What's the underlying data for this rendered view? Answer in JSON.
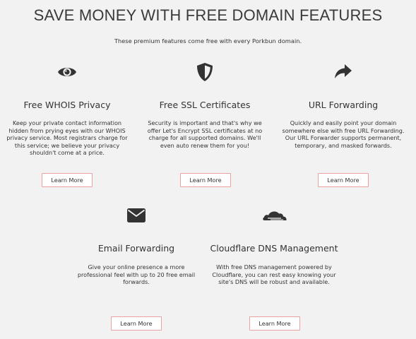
{
  "header": {
    "title": "SAVE MONEY WITH FREE DOMAIN FEATURES",
    "subtitle": "These premium features come free with every Porkbun domain."
  },
  "features": [
    {
      "icon": "eye-icon",
      "title": "Free WHOIS Privacy",
      "lines": [
        "Keep your private contact information",
        "hidden from prying eyes with our WHOIS",
        "privacy service. Most registrars charge for",
        "this service; we believe your privacy",
        "shouldn't come at a price."
      ],
      "button": "Learn More"
    },
    {
      "icon": "shield-icon",
      "title": "Free SSL Certificates",
      "lines": [
        "Security is important and that's why we",
        "offer Let's Encrypt SSL certificates at no",
        "charge for all supported domains. We'll",
        "even auto renew them for you!"
      ],
      "button": "Learn More"
    },
    {
      "icon": "share-arrow-icon",
      "title": "URL Forwarding",
      "lines": [
        "Quickly and easily point your domain",
        "somewhere else with free URL Forwarding.",
        "Our URL Forwarder supports permanent,",
        "temporary, and masked forwards."
      ],
      "button": "Learn More"
    },
    {
      "icon": "envelope-icon",
      "title": "Email Forwarding",
      "lines": [
        "Give your online presence a more",
        "professional feel with up to 20 free email",
        "forwards."
      ],
      "button": "Learn More"
    },
    {
      "icon": "cloudflare-icon",
      "title": "Cloudflare DNS Management",
      "lines": [
        "With free DNS management powered by",
        "Cloudflare, you can rest easy knowing your",
        "site's DNS will be robust and available."
      ],
      "button": "Learn More"
    }
  ],
  "colors": {
    "background": "#f2f2f2",
    "text": "#333333",
    "button_border": "#e9a1a1",
    "button_bg": "#ffffff"
  }
}
